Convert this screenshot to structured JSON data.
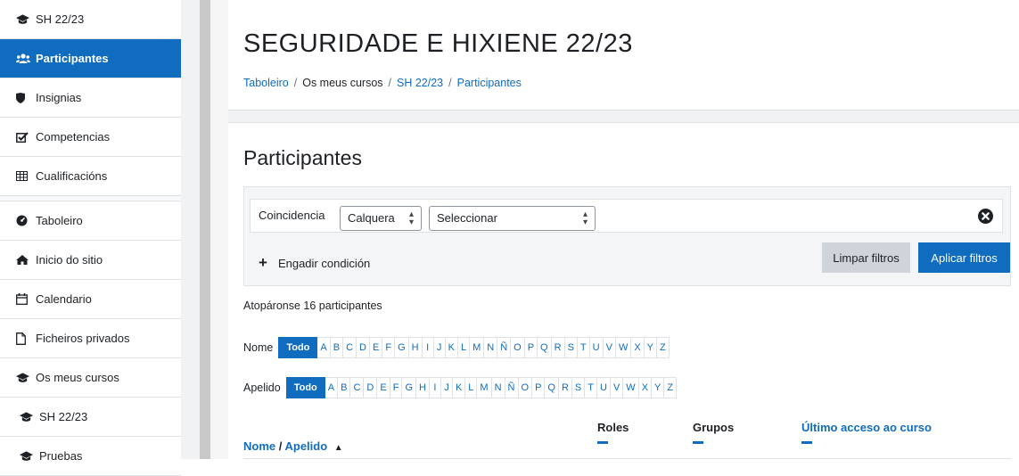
{
  "sidebar": {
    "items": [
      {
        "label": "SH 22/23",
        "icon": "graduation-cap-icon"
      },
      {
        "label": "Participantes",
        "icon": "users-icon",
        "active": true
      },
      {
        "label": "Insignias",
        "icon": "shield-icon"
      },
      {
        "label": "Competencias",
        "icon": "checkbox-icon"
      },
      {
        "label": "Cualificacións",
        "icon": "table-icon"
      },
      {
        "label": "Taboleiro",
        "icon": "dashboard-icon"
      },
      {
        "label": "Inicio do sitio",
        "icon": "home-icon"
      },
      {
        "label": "Calendario",
        "icon": "calendar-icon"
      },
      {
        "label": "Ficheiros privados",
        "icon": "file-icon"
      },
      {
        "label": "Os meus cursos",
        "icon": "graduation-cap-icon"
      },
      {
        "label": "SH 22/23",
        "icon": "graduation-cap-icon"
      },
      {
        "label": "Pruebas",
        "icon": "graduation-cap-icon"
      }
    ]
  },
  "header": {
    "course_title": "SEGURIDADE E HIXIENE 22/23",
    "breadcrumb": [
      "Taboleiro",
      "Os meus cursos",
      "SH 22/23",
      "Participantes"
    ],
    "breadcrumb_sep": "/"
  },
  "main": {
    "title": "Participantes",
    "filter": {
      "match_label": "Coincidencia",
      "match_value": "Calquera",
      "select_value": "Seleccionar",
      "add_condition": "Engadir condición",
      "clear_label": "Limpar filtros",
      "apply_label": "Aplicar filtros"
    },
    "found_text": "Atopáronse 16 participantes",
    "initials": {
      "first_label": "Nome",
      "last_label": "Apelido",
      "all_label": "Todo",
      "letters": [
        "A",
        "B",
        "C",
        "D",
        "E",
        "F",
        "G",
        "H",
        "I",
        "J",
        "K",
        "L",
        "M",
        "N",
        "Ñ",
        "O",
        "P",
        "Q",
        "R",
        "S",
        "T",
        "U",
        "V",
        "W",
        "X",
        "Y",
        "Z"
      ]
    },
    "table": {
      "col_first": "Nome",
      "col_sep": " / ",
      "col_last": "Apelido",
      "col_roles": "Roles",
      "col_groups": "Grupos",
      "col_access": "Último acceso ao curso"
    }
  },
  "colors": {
    "accent": "#0f6cbf",
    "text": "#1d2125",
    "muted_button": "#ced4da",
    "border": "#dee2e6"
  }
}
